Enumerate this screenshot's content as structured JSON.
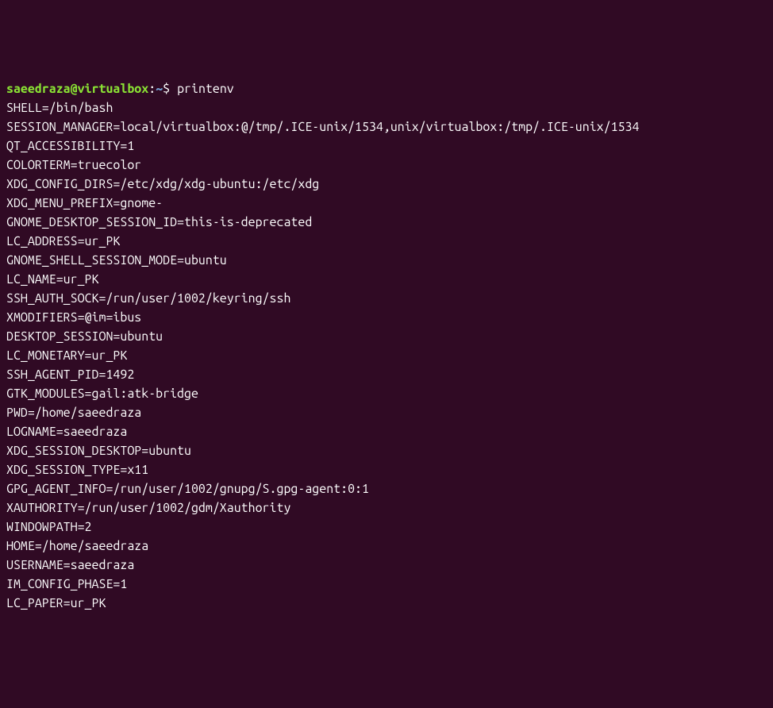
{
  "prompt": {
    "user": "saeedraza",
    "at": "@",
    "host": "virtualbox",
    "colon": ":",
    "path": "~",
    "dollar": "$ "
  },
  "command": "printenv",
  "env_vars": [
    "SHELL=/bin/bash",
    "SESSION_MANAGER=local/virtualbox:@/tmp/.ICE-unix/1534,unix/virtualbox:/tmp/.ICE-unix/1534",
    "QT_ACCESSIBILITY=1",
    "COLORTERM=truecolor",
    "XDG_CONFIG_DIRS=/etc/xdg/xdg-ubuntu:/etc/xdg",
    "XDG_MENU_PREFIX=gnome-",
    "GNOME_DESKTOP_SESSION_ID=this-is-deprecated",
    "LC_ADDRESS=ur_PK",
    "GNOME_SHELL_SESSION_MODE=ubuntu",
    "LC_NAME=ur_PK",
    "SSH_AUTH_SOCK=/run/user/1002/keyring/ssh",
    "XMODIFIERS=@im=ibus",
    "DESKTOP_SESSION=ubuntu",
    "LC_MONETARY=ur_PK",
    "SSH_AGENT_PID=1492",
    "GTK_MODULES=gail:atk-bridge",
    "PWD=/home/saeedraza",
    "LOGNAME=saeedraza",
    "XDG_SESSION_DESKTOP=ubuntu",
    "XDG_SESSION_TYPE=x11",
    "GPG_AGENT_INFO=/run/user/1002/gnupg/S.gpg-agent:0:1",
    "XAUTHORITY=/run/user/1002/gdm/Xauthority",
    "WINDOWPATH=2",
    "HOME=/home/saeedraza",
    "USERNAME=saeedraza",
    "IM_CONFIG_PHASE=1",
    "LC_PAPER=ur_PK"
  ]
}
